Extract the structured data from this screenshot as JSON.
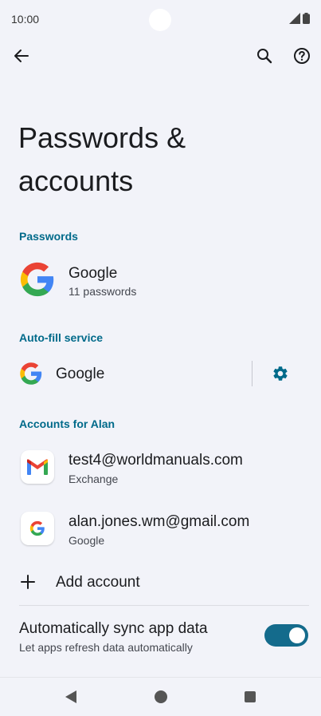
{
  "status_bar": {
    "time": "10:00"
  },
  "page": {
    "title_line1": "Passwords &",
    "title_line2": "accounts"
  },
  "passwords": {
    "header": "Passwords",
    "item": {
      "title": "Google",
      "subtitle": "11 passwords",
      "icon": "google-logo"
    }
  },
  "autofill": {
    "header": "Auto-fill service",
    "item": {
      "title": "Google",
      "icon": "google-logo",
      "settings_icon": "gear-icon"
    }
  },
  "accounts": {
    "header": "Accounts for Alan",
    "items": [
      {
        "title": "test4@worldmanuals.com",
        "subtitle": "Exchange",
        "icon": "gmail-icon"
      },
      {
        "title": "alan.jones.wm@gmail.com",
        "subtitle": "Google",
        "icon": "google-icon"
      }
    ],
    "add_label": "Add account"
  },
  "sync": {
    "title": "Automatically sync app data",
    "subtitle": "Let apps refresh data automatically",
    "enabled": true
  },
  "colors": {
    "accent": "#006a8a",
    "toggle": "#146b8c",
    "background": "#f2f3f9"
  }
}
